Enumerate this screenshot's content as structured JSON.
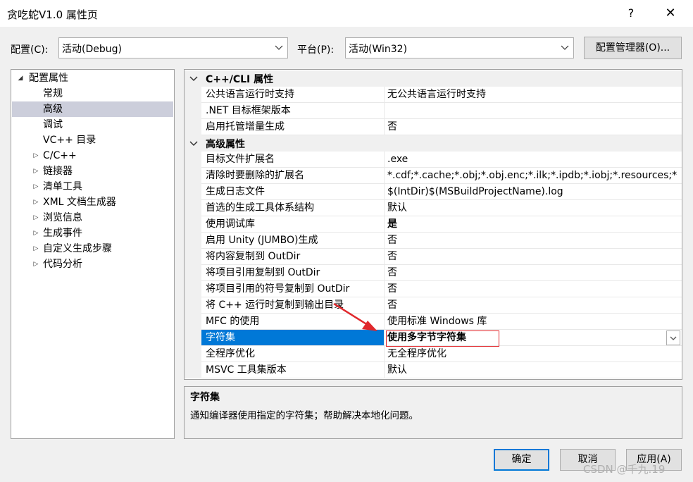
{
  "window": {
    "title": "贪吃蛇V1.0 属性页",
    "help_glyph": "?",
    "close_glyph": "✕"
  },
  "config": {
    "config_label": "配置(C):",
    "config_value": "活动(Debug)",
    "platform_label": "平台(P):",
    "platform_value": "活动(Win32)",
    "manager_button": "配置管理器(O)..."
  },
  "tree": {
    "root": {
      "label": "配置属性",
      "expanded": true
    },
    "items": [
      {
        "label": "常规",
        "level": 1,
        "expandable": false
      },
      {
        "label": "高级",
        "level": 1,
        "expandable": false,
        "selected": true
      },
      {
        "label": "调试",
        "level": 1,
        "expandable": false
      },
      {
        "label": "VC++ 目录",
        "level": 1,
        "expandable": false
      },
      {
        "label": "C/C++",
        "level": 1,
        "expandable": true
      },
      {
        "label": "链接器",
        "level": 1,
        "expandable": true
      },
      {
        "label": "清单工具",
        "level": 1,
        "expandable": true
      },
      {
        "label": "XML 文档生成器",
        "level": 1,
        "expandable": true
      },
      {
        "label": "浏览信息",
        "level": 1,
        "expandable": true
      },
      {
        "label": "生成事件",
        "level": 1,
        "expandable": true
      },
      {
        "label": "自定义生成步骤",
        "level": 1,
        "expandable": true
      },
      {
        "label": "代码分析",
        "level": 1,
        "expandable": true
      }
    ]
  },
  "grid": {
    "categories": [
      {
        "name": "C++/CLI 属性",
        "properties": [
          {
            "name": "公共语言运行时支持",
            "value": "无公共语言运行时支持"
          },
          {
            "name": ".NET 目标框架版本",
            "value": ""
          },
          {
            "name": "启用托管增量生成",
            "value": "否"
          }
        ]
      },
      {
        "name": "高级属性",
        "properties": [
          {
            "name": "目标文件扩展名",
            "value": ".exe"
          },
          {
            "name": "清除时要删除的扩展名",
            "value": "*.cdf;*.cache;*.obj;*.obj.enc;*.ilk;*.ipdb;*.iobj;*.resources;*"
          },
          {
            "name": "生成日志文件",
            "value": "$(IntDir)$(MSBuildProjectName).log"
          },
          {
            "name": "首选的生成工具体系结构",
            "value": "默认"
          },
          {
            "name": "使用调试库",
            "value": "是",
            "bold": true
          },
          {
            "name": "启用 Unity (JUMBO)生成",
            "value": "否"
          },
          {
            "name": "将内容复制到 OutDir",
            "value": "否"
          },
          {
            "name": "将项目引用复制到 OutDir",
            "value": "否"
          },
          {
            "name": "将项目引用的符号复制到 OutDir",
            "value": "否"
          },
          {
            "name": "将 C++ 运行时复制到输出目录",
            "value": "否"
          },
          {
            "name": "MFC 的使用",
            "value": "使用标准 Windows 库"
          },
          {
            "name": "字符集",
            "value": "使用多字节字符集",
            "selected": true
          },
          {
            "name": "全程序优化",
            "value": "无全程序优化"
          },
          {
            "name": "MSVC 工具集版本",
            "value": "默认"
          }
        ]
      }
    ]
  },
  "description": {
    "title": "字符集",
    "text": "通知编译器使用指定的字符集；帮助解决本地化问题。"
  },
  "buttons": {
    "ok": "确定",
    "cancel": "取消",
    "apply": "应用(A)"
  },
  "watermark": "CSDN @千九.19",
  "colors": {
    "selection": "#0078d7",
    "annotation": "#e0282c",
    "tree_selection": "#cccedb"
  },
  "icons": {
    "expanded": "filled-triangle-down-icon",
    "collapsed": "triangle-right-icon",
    "dropdown": "chevron-down-icon",
    "annotation_arrow": "red-arrow"
  }
}
